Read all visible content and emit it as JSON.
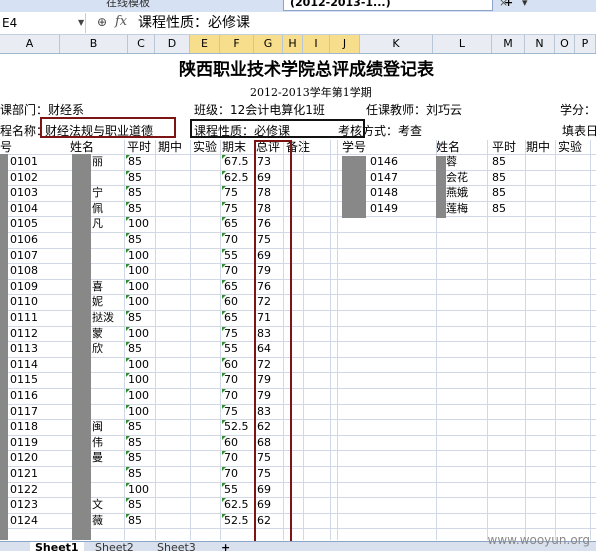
{
  "window": {
    "tab_inactive_label": "在线模板",
    "tab_active_label": "(2012-2013-1...)",
    "tab_close": "×",
    "tab_new": "+",
    "tab_dropdown": "▾"
  },
  "formula_bar": {
    "name_box": "E4",
    "zoom_glyph": "⊕",
    "fx": "fx",
    "value": "课程性质：必修课"
  },
  "columns": [
    "A",
    "B",
    "C",
    "D",
    "E",
    "F",
    "G",
    "H",
    "I",
    "J",
    "K",
    "L",
    "M",
    "N",
    "O",
    "P"
  ],
  "selected_columns": [
    "E",
    "F",
    "G",
    "H",
    "I",
    "J"
  ],
  "sheet": {
    "title": "陕西职业技术学院总评成绩登记表",
    "subtitle": "2012-2013学年第1学期",
    "dept": "课部门：财经系",
    "class": "班级：12会计电算化1班",
    "teacher": "任课教师：刘巧云",
    "credit": "学分：",
    "course_label": "程名称：",
    "course_name": "财经法规与职业道德",
    "course_type": "课程性质：必修课",
    "exam_method": "考核方式：考查",
    "fill_date": "填表日",
    "headers_left": [
      "号",
      "姓名",
      "平时",
      "期中",
      "实验",
      "期末",
      "总评",
      "备注"
    ],
    "headers_right": [
      "学号",
      "姓名",
      "平时",
      "期中",
      "实验"
    ],
    "rows_left": [
      {
        "id": "0101",
        "name": "丽",
        "ps": "85",
        "qm": "67.5",
        "zp": "73"
      },
      {
        "id": "0102",
        "name": "",
        "ps": "85",
        "qm": "62.5",
        "zp": "69"
      },
      {
        "id": "0103",
        "name": "宁",
        "ps": "85",
        "qm": "75",
        "zp": "78"
      },
      {
        "id": "0104",
        "name": "佩",
        "ps": "85",
        "qm": "75",
        "zp": "78"
      },
      {
        "id": "0105",
        "name": "凡",
        "ps": "100",
        "qm": "65",
        "zp": "76"
      },
      {
        "id": "0106",
        "name": "",
        "ps": "85",
        "qm": "70",
        "zp": "75"
      },
      {
        "id": "0107",
        "name": "",
        "ps": "100",
        "qm": "55",
        "zp": "69"
      },
      {
        "id": "0108",
        "name": "",
        "ps": "100",
        "qm": "70",
        "zp": "79"
      },
      {
        "id": "0109",
        "name": "喜",
        "ps": "100",
        "qm": "65",
        "zp": "76"
      },
      {
        "id": "0110",
        "name": "妮",
        "ps": "100",
        "qm": "60",
        "zp": "72"
      },
      {
        "id": "0111",
        "name": "挞泼",
        "ps": "85",
        "qm": "65",
        "zp": "71"
      },
      {
        "id": "0112",
        "name": "蒙",
        "ps": "100",
        "qm": "75",
        "zp": "83"
      },
      {
        "id": "0113",
        "name": "欣",
        "ps": "85",
        "qm": "55",
        "zp": "64"
      },
      {
        "id": "0114",
        "name": "",
        "ps": "100",
        "qm": "60",
        "zp": "72"
      },
      {
        "id": "0115",
        "name": "",
        "ps": "100",
        "qm": "70",
        "zp": "79"
      },
      {
        "id": "0116",
        "name": "",
        "ps": "100",
        "qm": "70",
        "zp": "79"
      },
      {
        "id": "0117",
        "name": "",
        "ps": "100",
        "qm": "75",
        "zp": "83"
      },
      {
        "id": "0118",
        "name": "闽",
        "ps": "85",
        "qm": "52.5",
        "zp": "62"
      },
      {
        "id": "0119",
        "name": "伟",
        "ps": "85",
        "qm": "60",
        "zp": "68"
      },
      {
        "id": "0120",
        "name": "曼",
        "ps": "85",
        "qm": "70",
        "zp": "75"
      },
      {
        "id": "0121",
        "name": "",
        "ps": "85",
        "qm": "70",
        "zp": "75"
      },
      {
        "id": "0122",
        "name": "",
        "ps": "100",
        "qm": "55",
        "zp": "69"
      },
      {
        "id": "0123",
        "name": "文",
        "ps": "85",
        "qm": "62.5",
        "zp": "69"
      },
      {
        "id": "0124",
        "name": "薇",
        "ps": "85",
        "qm": "52.5",
        "zp": "62"
      }
    ],
    "rows_right": [
      {
        "id": "0146",
        "name": "蓉",
        "ps": "85"
      },
      {
        "id": "0147",
        "name": "会花",
        "ps": "85"
      },
      {
        "id": "0148",
        "name": "燕娥",
        "ps": "85"
      },
      {
        "id": "0149",
        "name": "莲梅",
        "ps": "85"
      }
    ]
  },
  "sheet_tabs": [
    "Sheet1",
    "Sheet2",
    "Sheet3"
  ],
  "add_sheet": "+",
  "watermark": "www.wooyun.org",
  "colors": {
    "highlight_box": "#7d1414",
    "selected_header": "#f7de8c",
    "grid": "#d0d7e5",
    "mask": "#888888"
  }
}
